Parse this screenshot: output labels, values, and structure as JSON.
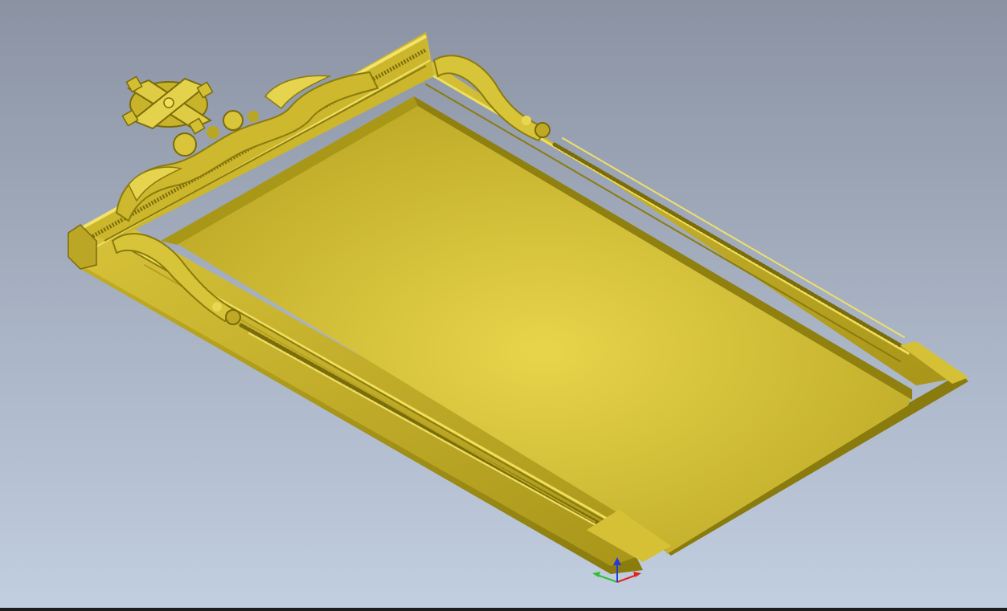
{
  "viewport": {
    "background_top": "#8b93a3",
    "background_bottom": "#c2cfe1",
    "model_color": "#d9c432",
    "model_highlight": "#e8d54c",
    "model_shadow": "#9a8a12",
    "model_dark": "#6f6408"
  },
  "axis_gizmo": {
    "x_color": "#e0241c",
    "y_color": "#2fbf2f",
    "z_color": "#2a3ad8"
  }
}
